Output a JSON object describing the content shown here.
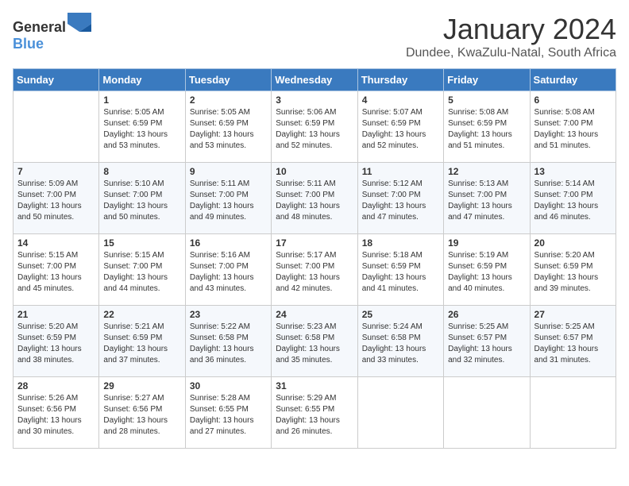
{
  "header": {
    "logo_general": "General",
    "logo_blue": "Blue",
    "month_title": "January 2024",
    "location": "Dundee, KwaZulu-Natal, South Africa"
  },
  "weekdays": [
    "Sunday",
    "Monday",
    "Tuesday",
    "Wednesday",
    "Thursday",
    "Friday",
    "Saturday"
  ],
  "weeks": [
    [
      {
        "day": "",
        "sunrise": "",
        "sunset": "",
        "daylight": ""
      },
      {
        "day": "1",
        "sunrise": "Sunrise: 5:05 AM",
        "sunset": "Sunset: 6:59 PM",
        "daylight": "Daylight: 13 hours and 53 minutes."
      },
      {
        "day": "2",
        "sunrise": "Sunrise: 5:05 AM",
        "sunset": "Sunset: 6:59 PM",
        "daylight": "Daylight: 13 hours and 53 minutes."
      },
      {
        "day": "3",
        "sunrise": "Sunrise: 5:06 AM",
        "sunset": "Sunset: 6:59 PM",
        "daylight": "Daylight: 13 hours and 52 minutes."
      },
      {
        "day": "4",
        "sunrise": "Sunrise: 5:07 AM",
        "sunset": "Sunset: 6:59 PM",
        "daylight": "Daylight: 13 hours and 52 minutes."
      },
      {
        "day": "5",
        "sunrise": "Sunrise: 5:08 AM",
        "sunset": "Sunset: 6:59 PM",
        "daylight": "Daylight: 13 hours and 51 minutes."
      },
      {
        "day": "6",
        "sunrise": "Sunrise: 5:08 AM",
        "sunset": "Sunset: 7:00 PM",
        "daylight": "Daylight: 13 hours and 51 minutes."
      }
    ],
    [
      {
        "day": "7",
        "sunrise": "Sunrise: 5:09 AM",
        "sunset": "Sunset: 7:00 PM",
        "daylight": "Daylight: 13 hours and 50 minutes."
      },
      {
        "day": "8",
        "sunrise": "Sunrise: 5:10 AM",
        "sunset": "Sunset: 7:00 PM",
        "daylight": "Daylight: 13 hours and 50 minutes."
      },
      {
        "day": "9",
        "sunrise": "Sunrise: 5:11 AM",
        "sunset": "Sunset: 7:00 PM",
        "daylight": "Daylight: 13 hours and 49 minutes."
      },
      {
        "day": "10",
        "sunrise": "Sunrise: 5:11 AM",
        "sunset": "Sunset: 7:00 PM",
        "daylight": "Daylight: 13 hours and 48 minutes."
      },
      {
        "day": "11",
        "sunrise": "Sunrise: 5:12 AM",
        "sunset": "Sunset: 7:00 PM",
        "daylight": "Daylight: 13 hours and 47 minutes."
      },
      {
        "day": "12",
        "sunrise": "Sunrise: 5:13 AM",
        "sunset": "Sunset: 7:00 PM",
        "daylight": "Daylight: 13 hours and 47 minutes."
      },
      {
        "day": "13",
        "sunrise": "Sunrise: 5:14 AM",
        "sunset": "Sunset: 7:00 PM",
        "daylight": "Daylight: 13 hours and 46 minutes."
      }
    ],
    [
      {
        "day": "14",
        "sunrise": "Sunrise: 5:15 AM",
        "sunset": "Sunset: 7:00 PM",
        "daylight": "Daylight: 13 hours and 45 minutes."
      },
      {
        "day": "15",
        "sunrise": "Sunrise: 5:15 AM",
        "sunset": "Sunset: 7:00 PM",
        "daylight": "Daylight: 13 hours and 44 minutes."
      },
      {
        "day": "16",
        "sunrise": "Sunrise: 5:16 AM",
        "sunset": "Sunset: 7:00 PM",
        "daylight": "Daylight: 13 hours and 43 minutes."
      },
      {
        "day": "17",
        "sunrise": "Sunrise: 5:17 AM",
        "sunset": "Sunset: 7:00 PM",
        "daylight": "Daylight: 13 hours and 42 minutes."
      },
      {
        "day": "18",
        "sunrise": "Sunrise: 5:18 AM",
        "sunset": "Sunset: 6:59 PM",
        "daylight": "Daylight: 13 hours and 41 minutes."
      },
      {
        "day": "19",
        "sunrise": "Sunrise: 5:19 AM",
        "sunset": "Sunset: 6:59 PM",
        "daylight": "Daylight: 13 hours and 40 minutes."
      },
      {
        "day": "20",
        "sunrise": "Sunrise: 5:20 AM",
        "sunset": "Sunset: 6:59 PM",
        "daylight": "Daylight: 13 hours and 39 minutes."
      }
    ],
    [
      {
        "day": "21",
        "sunrise": "Sunrise: 5:20 AM",
        "sunset": "Sunset: 6:59 PM",
        "daylight": "Daylight: 13 hours and 38 minutes."
      },
      {
        "day": "22",
        "sunrise": "Sunrise: 5:21 AM",
        "sunset": "Sunset: 6:59 PM",
        "daylight": "Daylight: 13 hours and 37 minutes."
      },
      {
        "day": "23",
        "sunrise": "Sunrise: 5:22 AM",
        "sunset": "Sunset: 6:58 PM",
        "daylight": "Daylight: 13 hours and 36 minutes."
      },
      {
        "day": "24",
        "sunrise": "Sunrise: 5:23 AM",
        "sunset": "Sunset: 6:58 PM",
        "daylight": "Daylight: 13 hours and 35 minutes."
      },
      {
        "day": "25",
        "sunrise": "Sunrise: 5:24 AM",
        "sunset": "Sunset: 6:58 PM",
        "daylight": "Daylight: 13 hours and 33 minutes."
      },
      {
        "day": "26",
        "sunrise": "Sunrise: 5:25 AM",
        "sunset": "Sunset: 6:57 PM",
        "daylight": "Daylight: 13 hours and 32 minutes."
      },
      {
        "day": "27",
        "sunrise": "Sunrise: 5:25 AM",
        "sunset": "Sunset: 6:57 PM",
        "daylight": "Daylight: 13 hours and 31 minutes."
      }
    ],
    [
      {
        "day": "28",
        "sunrise": "Sunrise: 5:26 AM",
        "sunset": "Sunset: 6:56 PM",
        "daylight": "Daylight: 13 hours and 30 minutes."
      },
      {
        "day": "29",
        "sunrise": "Sunrise: 5:27 AM",
        "sunset": "Sunset: 6:56 PM",
        "daylight": "Daylight: 13 hours and 28 minutes."
      },
      {
        "day": "30",
        "sunrise": "Sunrise: 5:28 AM",
        "sunset": "Sunset: 6:55 PM",
        "daylight": "Daylight: 13 hours and 27 minutes."
      },
      {
        "day": "31",
        "sunrise": "Sunrise: 5:29 AM",
        "sunset": "Sunset: 6:55 PM",
        "daylight": "Daylight: 13 hours and 26 minutes."
      },
      {
        "day": "",
        "sunrise": "",
        "sunset": "",
        "daylight": ""
      },
      {
        "day": "",
        "sunrise": "",
        "sunset": "",
        "daylight": ""
      },
      {
        "day": "",
        "sunrise": "",
        "sunset": "",
        "daylight": ""
      }
    ]
  ]
}
